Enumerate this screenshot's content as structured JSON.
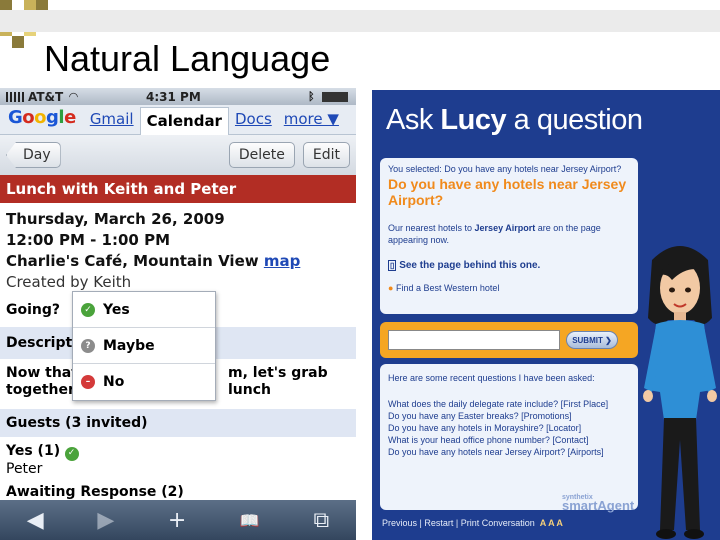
{
  "slide": {
    "title": "Natural Language"
  },
  "phone": {
    "status": {
      "carrier": "AT&T",
      "time": "4:31 PM"
    },
    "tabs": [
      {
        "label": "Google"
      },
      {
        "label": "Gmail"
      },
      {
        "label": "Calendar"
      },
      {
        "label": "Docs"
      },
      {
        "label": "more ▼"
      }
    ],
    "toolbar": {
      "back_label": "Day",
      "delete_label": "Delete",
      "edit_label": "Edit"
    },
    "event": {
      "title": "Lunch with Keith and Peter",
      "date": "Thursday, March 26, 2009",
      "time": "12:00 PM - 1:00 PM",
      "location": "Charlie's Café, Mountain View",
      "map_label": "map",
      "created": "Created by Keith"
    },
    "going_label": "Going?",
    "rsvp_options": [
      {
        "label": "Yes"
      },
      {
        "label": "Maybe"
      },
      {
        "label": "No"
      }
    ],
    "description_label": "Descript",
    "description_line1": "Now that",
    "description_line1_tail": "m, let's grab lunch",
    "description_line2": "together!",
    "guests_header": "Guests (3 invited)",
    "guests_yes": "Yes (1)",
    "guest_name": "Peter",
    "awaiting": "Awaiting Response (2)",
    "bottom_icons": [
      "◀",
      "▶",
      "+",
      "📖",
      "⧉"
    ]
  },
  "lucy": {
    "title_pre": "Ask ",
    "title_name": "Lucy",
    "title_post": " a question",
    "selected_text": "You selected: Do you have any hotels near Jersey Airport?",
    "question": "Do you have any hotels near Jersey Airport?",
    "answer_pre": "Our nearest hotels to ",
    "answer_bold": "Jersey Airport",
    "answer_post": " are on the page appearing now.",
    "see_page": "See the page behind this one.",
    "find_hotel": "Find a Best Western hotel",
    "submit_label": "SUBMIT",
    "recent_title": "Here are some recent questions I have been asked:",
    "recent_questions": [
      "What does the daily delegate rate include? [First Place]",
      "Do you have any Easter breaks? [Promotions]",
      "Do you have any hotels in Morayshire? [Locator]",
      "What is your head office phone number? [Contact]",
      "Do you have any hotels near Jersey Airport? [Airports]"
    ],
    "brand_small": "synthetix",
    "brand": "smartAgent",
    "footer": "Previous | Restart | Print Conversation",
    "text_size": "A A A"
  }
}
